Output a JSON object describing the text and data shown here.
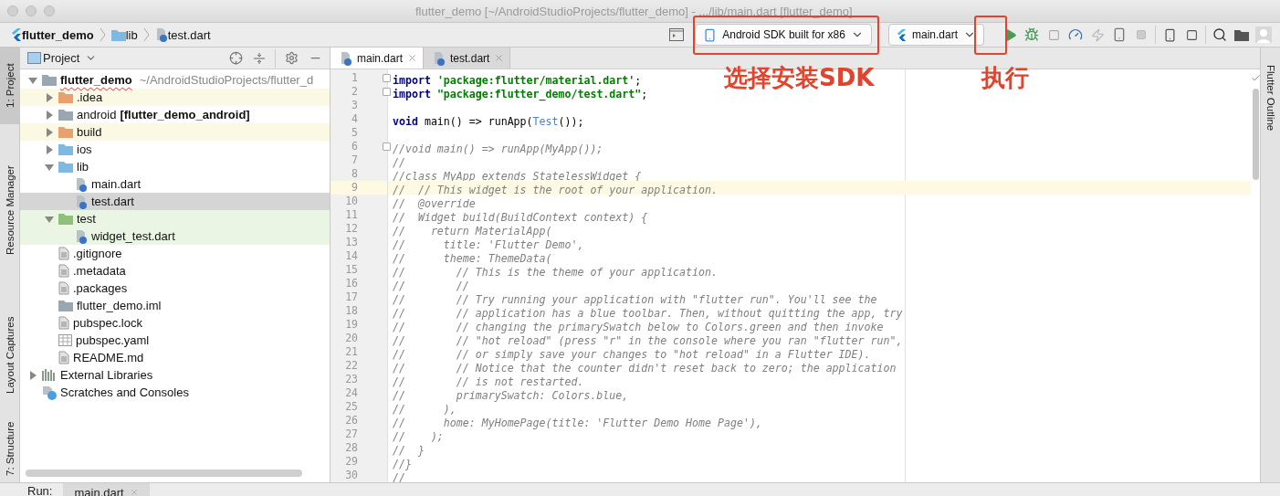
{
  "window": {
    "title": "flutter_demo [~/AndroidStudioProjects/flutter_demo] - .../lib/main.dart [flutter_demo]"
  },
  "breadcrumbs": [
    {
      "kind": "project",
      "label": "flutter_demo"
    },
    {
      "kind": "folder",
      "label": "lib"
    },
    {
      "kind": "dart",
      "label": "test.dart"
    }
  ],
  "toolbar": {
    "device": "Android SDK built for x86",
    "run_config": "main.dart"
  },
  "left_tool_tabs": [
    {
      "label": "1: Project",
      "selected": true
    },
    {
      "label": "Resource Manager",
      "selected": false
    },
    {
      "label": "Layout Captures",
      "selected": false
    },
    {
      "label": "7: Structure",
      "selected": false
    }
  ],
  "right_tool_tabs": [
    {
      "label": "Flutter Outline",
      "selected": false
    }
  ],
  "project_panel": {
    "title": "Project",
    "tree": [
      {
        "kind": "module",
        "label": "flutter_demo",
        "detail": "~/AndroidStudioProjects/flutter_d",
        "excluded": false,
        "test": false,
        "selected": false,
        "expanded": true,
        "children": [
          {
            "kind": "excluded",
            "label": ".idea",
            "excluded": true,
            "test": false,
            "selected": false,
            "expanded": false
          },
          {
            "kind": "module",
            "label": "android",
            "detail_bold": "[flutter_demo_android]",
            "excluded": false,
            "test": false,
            "selected": false,
            "expanded": false
          },
          {
            "kind": "excluded",
            "label": "build",
            "excluded": true,
            "test": false,
            "selected": false,
            "expanded": false
          },
          {
            "kind": "folder",
            "label": "ios",
            "excluded": false,
            "test": false,
            "selected": false,
            "expanded": false
          },
          {
            "kind": "folder",
            "label": "lib",
            "excluded": false,
            "test": false,
            "selected": false,
            "expanded": true,
            "children": [
              {
                "kind": "dart",
                "label": "main.dart",
                "excluded": false,
                "test": false,
                "selected": false
              },
              {
                "kind": "dart",
                "label": "test.dart",
                "excluded": false,
                "test": false,
                "selected": true
              }
            ]
          },
          {
            "kind": "testfolder",
            "label": "test",
            "excluded": false,
            "test": true,
            "selected": false,
            "expanded": true,
            "children": [
              {
                "kind": "dart",
                "label": "widget_test.dart",
                "excluded": false,
                "test": true,
                "selected": false
              }
            ]
          },
          {
            "kind": "file",
            "label": ".gitignore",
            "excluded": false,
            "test": false,
            "selected": false
          },
          {
            "kind": "file",
            "label": ".metadata",
            "excluded": false,
            "test": false,
            "selected": false
          },
          {
            "kind": "file",
            "label": ".packages",
            "excluded": false,
            "test": false,
            "selected": false
          },
          {
            "kind": "module",
            "label": "flutter_demo.iml",
            "excluded": false,
            "test": false,
            "selected": false
          },
          {
            "kind": "file",
            "label": "pubspec.lock",
            "excluded": false,
            "test": false,
            "selected": false
          },
          {
            "kind": "table",
            "label": "pubspec.yaml",
            "excluded": false,
            "test": false,
            "selected": false
          },
          {
            "kind": "file",
            "label": "README.md",
            "excluded": false,
            "test": false,
            "selected": false
          }
        ]
      },
      {
        "kind": "libraries",
        "label": "External Libraries",
        "excluded": false,
        "test": false,
        "selected": false,
        "expanded": false
      },
      {
        "kind": "scratches",
        "label": "Scratches and Consoles",
        "excluded": false,
        "test": false,
        "selected": false
      }
    ]
  },
  "editor": {
    "tabs": [
      {
        "label": "main.dart",
        "selected": true
      },
      {
        "label": "test.dart",
        "selected": false
      }
    ],
    "lines": [
      {
        "number": "1",
        "highlighted": false,
        "fold": true,
        "segments": [
          {
            "kind": "keyword",
            "text": "import "
          },
          {
            "kind": "string",
            "text": "'package:flutter/material.dart'"
          },
          {
            "kind": "plain",
            "text": ";"
          }
        ]
      },
      {
        "number": "2",
        "highlighted": false,
        "fold": true,
        "segments": [
          {
            "kind": "keyword",
            "text": "import "
          },
          {
            "kind": "string",
            "text": "\"package:flutter_demo/test.dart\""
          },
          {
            "kind": "plain",
            "text": ";"
          }
        ]
      },
      {
        "number": "3",
        "highlighted": false,
        "fold": false
      },
      {
        "number": "4",
        "highlighted": false,
        "fold": false,
        "segments": [
          {
            "kind": "keyword",
            "text": "void"
          },
          {
            "kind": "plain",
            "text": " main() => runApp("
          },
          {
            "kind": "class",
            "text": "Test"
          },
          {
            "kind": "plain",
            "text": "());"
          }
        ]
      },
      {
        "number": "5",
        "highlighted": false,
        "fold": false
      },
      {
        "number": "6",
        "highlighted": false,
        "fold": true,
        "segments": [
          {
            "kind": "comment",
            "text": "//void main() => runApp(MyApp());"
          }
        ]
      },
      {
        "number": "7",
        "highlighted": false,
        "fold": false,
        "segments": [
          {
            "kind": "comment",
            "text": "//"
          }
        ]
      },
      {
        "number": "8",
        "highlighted": false,
        "fold": false,
        "segments": [
          {
            "kind": "comment",
            "text": "//class MyApp extends StatelessWidget {"
          }
        ]
      },
      {
        "number": "9",
        "highlighted": true,
        "fold": false,
        "segments": [
          {
            "kind": "comment",
            "text": "//  // This widget is the root of your application."
          }
        ]
      },
      {
        "number": "10",
        "highlighted": false,
        "fold": false,
        "segments": [
          {
            "kind": "comment",
            "text": "//  @override"
          }
        ]
      },
      {
        "number": "11",
        "highlighted": false,
        "fold": false,
        "segments": [
          {
            "kind": "comment",
            "text": "//  Widget build(BuildContext context) {"
          }
        ]
      },
      {
        "number": "12",
        "highlighted": false,
        "fold": false,
        "segments": [
          {
            "kind": "comment",
            "text": "//    return MaterialApp("
          }
        ]
      },
      {
        "number": "13",
        "highlighted": false,
        "fold": false,
        "segments": [
          {
            "kind": "comment",
            "text": "//      title: 'Flutter Demo',"
          }
        ]
      },
      {
        "number": "14",
        "highlighted": false,
        "fold": false,
        "segments": [
          {
            "kind": "comment",
            "text": "//      theme: ThemeData("
          }
        ]
      },
      {
        "number": "15",
        "highlighted": false,
        "fold": false,
        "segments": [
          {
            "kind": "comment",
            "text": "//        // This is the theme of your application."
          }
        ]
      },
      {
        "number": "16",
        "highlighted": false,
        "fold": false,
        "segments": [
          {
            "kind": "comment",
            "text": "//        //"
          }
        ]
      },
      {
        "number": "17",
        "highlighted": false,
        "fold": false,
        "segments": [
          {
            "kind": "comment",
            "text": "//        // Try running your application with \"flutter run\". You'll see the"
          }
        ]
      },
      {
        "number": "18",
        "highlighted": false,
        "fold": false,
        "segments": [
          {
            "kind": "comment",
            "text": "//        // application has a blue toolbar. Then, without quitting the app, try"
          }
        ]
      },
      {
        "number": "19",
        "highlighted": false,
        "fold": false,
        "segments": [
          {
            "kind": "comment",
            "text": "//        // changing the primarySwatch below to Colors.green and then invoke"
          }
        ]
      },
      {
        "number": "20",
        "highlighted": false,
        "fold": false,
        "segments": [
          {
            "kind": "comment",
            "text": "//        // \"hot reload\" (press \"r\" in the console where you ran \"flutter run\","
          }
        ]
      },
      {
        "number": "21",
        "highlighted": false,
        "fold": false,
        "segments": [
          {
            "kind": "comment",
            "text": "//        // or simply save your changes to \"hot reload\" in a Flutter IDE)."
          }
        ]
      },
      {
        "number": "22",
        "highlighted": false,
        "fold": false,
        "segments": [
          {
            "kind": "comment",
            "text": "//        // Notice that the counter didn't reset back to zero; the application"
          }
        ]
      },
      {
        "number": "23",
        "highlighted": false,
        "fold": false,
        "segments": [
          {
            "kind": "comment",
            "text": "//        // is not restarted."
          }
        ]
      },
      {
        "number": "24",
        "highlighted": false,
        "fold": false,
        "segments": [
          {
            "kind": "comment",
            "text": "//        primarySwatch: Colors.blue,"
          }
        ]
      },
      {
        "number": "25",
        "highlighted": false,
        "fold": false,
        "segments": [
          {
            "kind": "comment",
            "text": "//      ),"
          }
        ]
      },
      {
        "number": "26",
        "highlighted": false,
        "fold": false,
        "segments": [
          {
            "kind": "comment",
            "text": "//      home: MyHomePage(title: 'Flutter Demo Home Page'),"
          }
        ]
      },
      {
        "number": "27",
        "highlighted": false,
        "fold": false,
        "segments": [
          {
            "kind": "comment",
            "text": "//    );"
          }
        ]
      },
      {
        "number": "28",
        "highlighted": false,
        "fold": false,
        "segments": [
          {
            "kind": "comment",
            "text": "//  }"
          }
        ]
      },
      {
        "number": "29",
        "highlighted": false,
        "fold": false,
        "segments": [
          {
            "kind": "comment",
            "text": "//}"
          }
        ]
      },
      {
        "number": "30",
        "highlighted": false,
        "fold": false,
        "segments": [
          {
            "kind": "comment",
            "text": "//"
          }
        ]
      }
    ]
  },
  "run_bar": {
    "label": "Run:",
    "tab": "main.dart"
  },
  "annotations": [
    {
      "text": "选择安装SDK"
    },
    {
      "text": "执行"
    }
  ]
}
